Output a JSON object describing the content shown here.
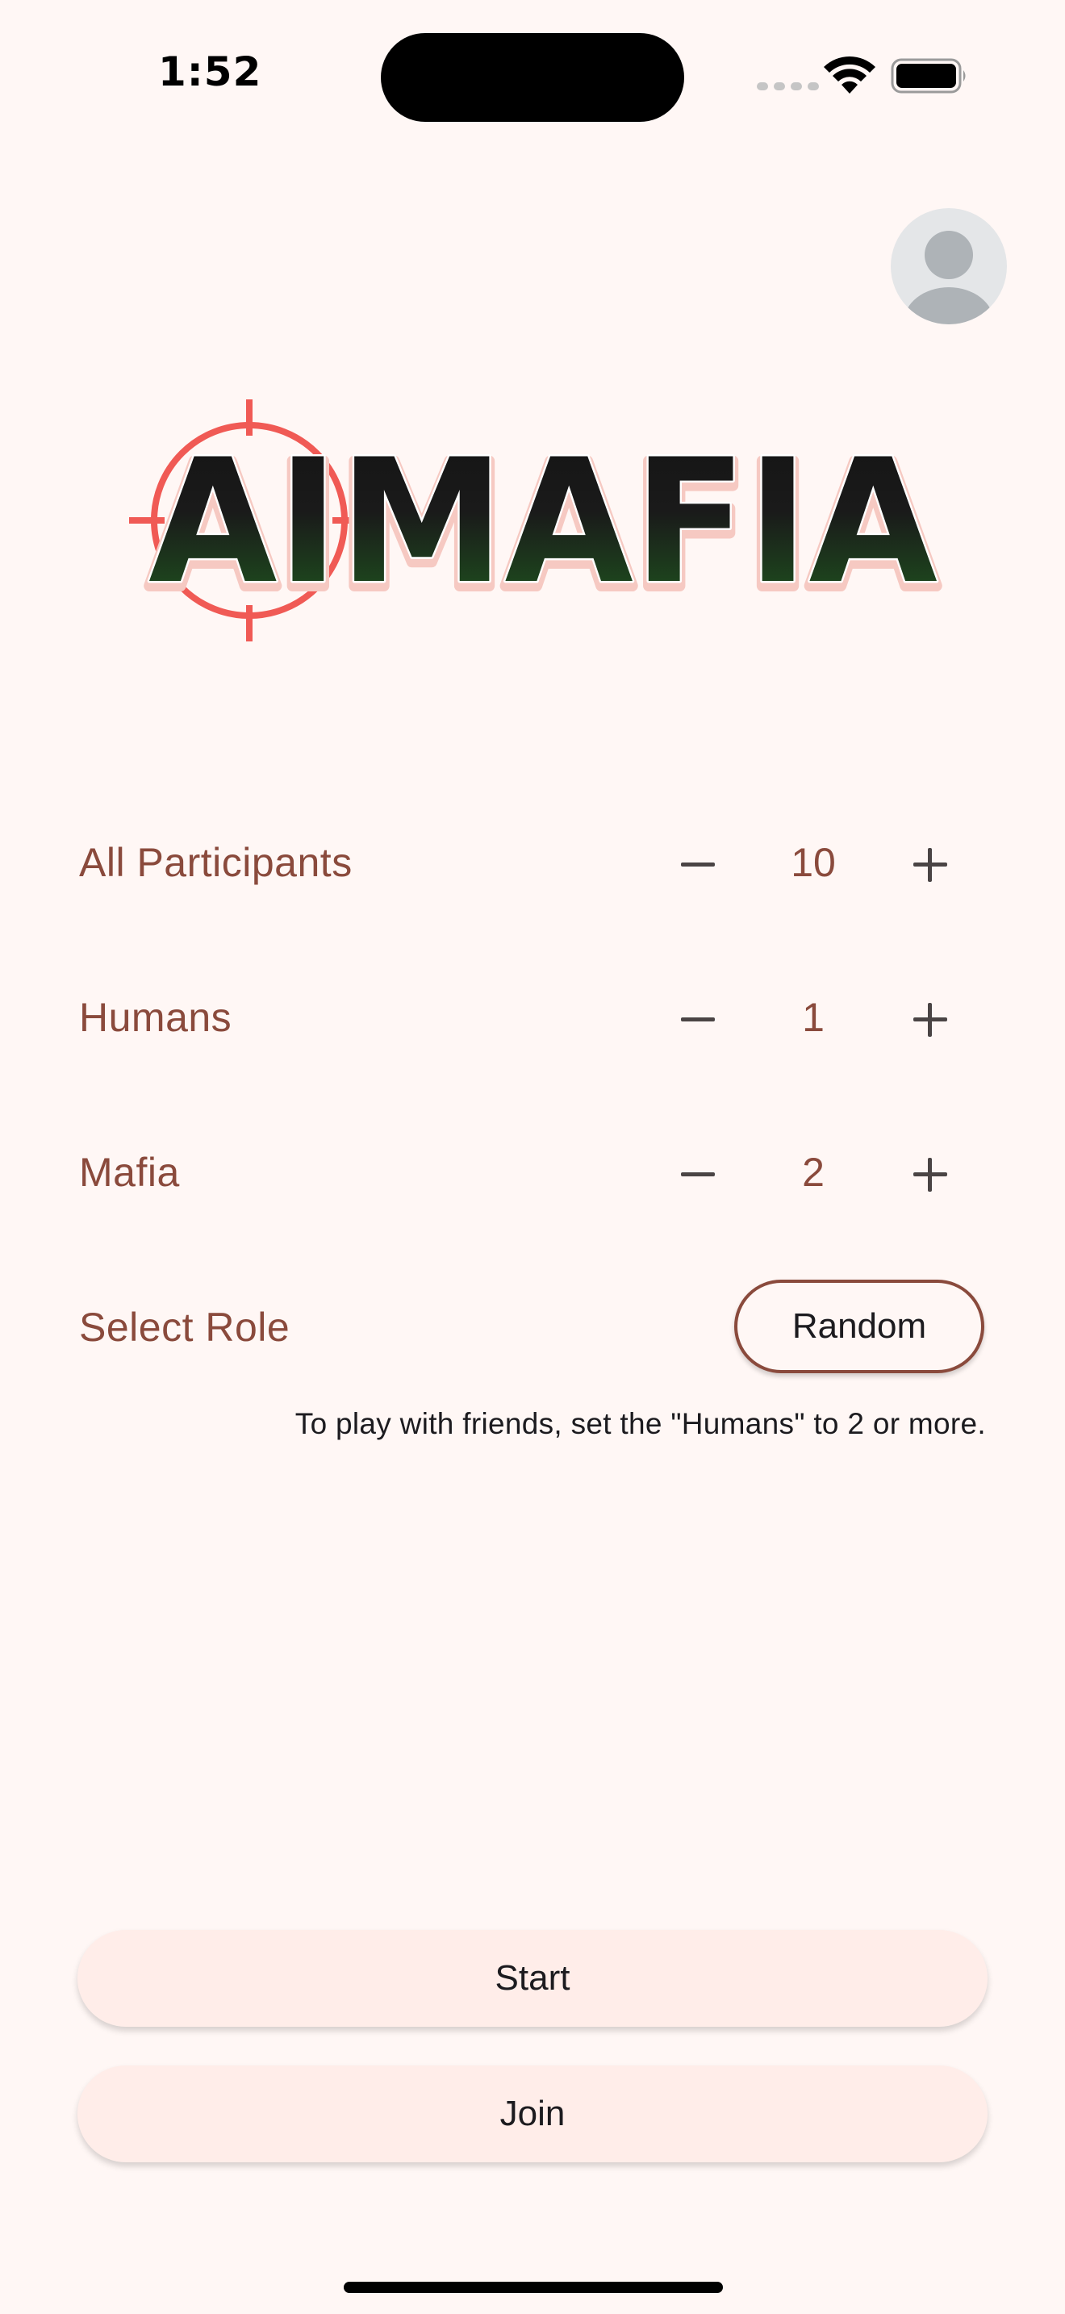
{
  "status_bar": {
    "time": "1:52"
  },
  "icons": {
    "avatar": "person-avatar-icon",
    "wifi": "wifi-icon",
    "battery": "battery-icon",
    "signal": "cellular-signal-icon",
    "crosshair": "crosshair-icon"
  },
  "logo": {
    "text": "AIMAFIA"
  },
  "settings": {
    "participants": {
      "label": "All Participants",
      "value": "10"
    },
    "humans": {
      "label": "Humans",
      "value": "1"
    },
    "mafia": {
      "label": "Mafia",
      "value": "2"
    },
    "role": {
      "label": "Select Role",
      "button": "Random"
    },
    "hint": "To play with friends, set the \"Humans\" to 2 or more."
  },
  "actions": {
    "start": "Start",
    "join": "Join"
  },
  "colors": {
    "background": "#FFF7F5",
    "label": "#8A4A3C",
    "button_fill": "#FFEDE9",
    "crosshair": "#F05A55",
    "logo_top": "#1A1A1A",
    "logo_bottom": "#1F5A1F"
  }
}
